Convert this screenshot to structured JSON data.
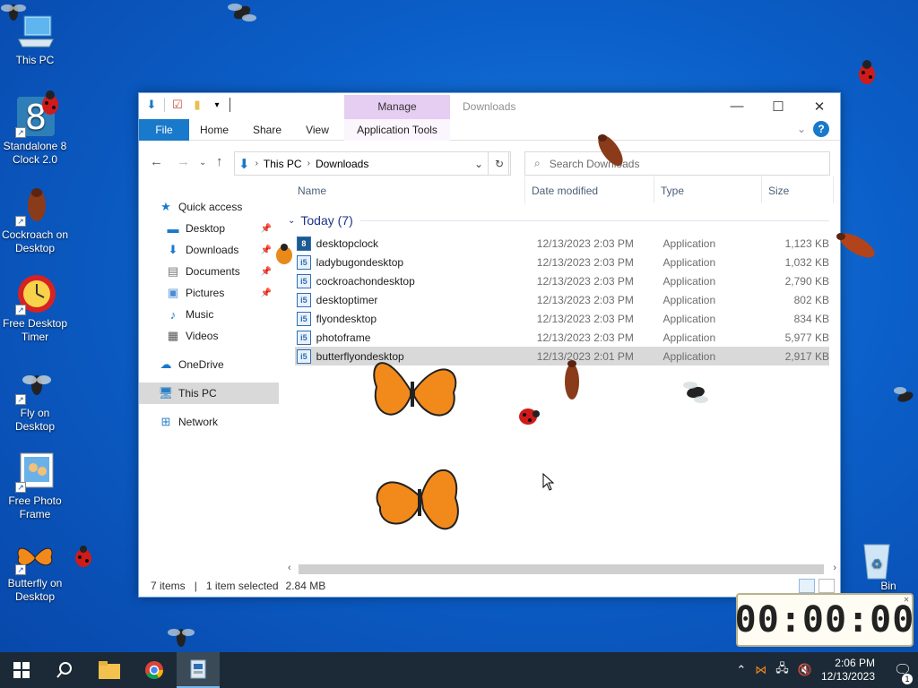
{
  "desktop": {
    "icons": [
      {
        "label": "This PC",
        "icon": "this-pc-icon"
      },
      {
        "label": "Standalone 8 Clock 2.0",
        "icon": "clock-8-icon"
      },
      {
        "label": "Cockroach on Desktop",
        "icon": "cockroach-icon"
      },
      {
        "label": "Free Desktop Timer",
        "icon": "timer-icon"
      },
      {
        "label": "Fly on Desktop",
        "icon": "fly-icon"
      },
      {
        "label": "Free Photo Frame",
        "icon": "photo-frame-icon"
      },
      {
        "label": "Butterfly on Desktop",
        "icon": "butterfly-icon"
      }
    ],
    "recycle_bin_label": "Bin"
  },
  "window": {
    "manage_tab": "Manage",
    "title": "Downloads",
    "ribbon_tabs": {
      "file": "File",
      "home": "Home",
      "share": "Share",
      "view": "View",
      "app_tools": "Application Tools"
    },
    "address": {
      "crumb1": "This PC",
      "crumb2": "Downloads"
    },
    "search_placeholder": "Search Downloads",
    "nav_pane": {
      "quick_access": "Quick access",
      "desktop": "Desktop",
      "downloads": "Downloads",
      "documents": "Documents",
      "pictures": "Pictures",
      "music": "Music",
      "videos": "Videos",
      "onedrive": "OneDrive",
      "this_pc": "This PC",
      "network": "Network"
    },
    "columns": {
      "name": "Name",
      "date": "Date modified",
      "type": "Type",
      "size": "Size"
    },
    "group_label": "Today (7)",
    "files": [
      {
        "name": "desktopclock",
        "date": "12/13/2023 2:03 PM",
        "type": "Application",
        "size": "1,123 KB"
      },
      {
        "name": "ladybugondesktop",
        "date": "12/13/2023 2:03 PM",
        "type": "Application",
        "size": "1,032 KB"
      },
      {
        "name": "cockroachondesktop",
        "date": "12/13/2023 2:03 PM",
        "type": "Application",
        "size": "2,790 KB"
      },
      {
        "name": "desktoptimer",
        "date": "12/13/2023 2:03 PM",
        "type": "Application",
        "size": "802 KB"
      },
      {
        "name": "flyondesktop",
        "date": "12/13/2023 2:03 PM",
        "type": "Application",
        "size": "834 KB"
      },
      {
        "name": "photoframe",
        "date": "12/13/2023 2:03 PM",
        "type": "Application",
        "size": "5,977 KB"
      },
      {
        "name": "butterflyondesktop",
        "date": "12/13/2023 2:01 PM",
        "type": "Application",
        "size": "2,917 KB"
      }
    ],
    "status": {
      "items": "7 items",
      "selected": "1 item selected",
      "size": "2.84 MB"
    }
  },
  "timer": {
    "display": "00:00:00"
  },
  "taskbar": {
    "time": "2:06 PM",
    "date": "12/13/2023",
    "notification_count": "1"
  },
  "colors": {
    "accent": "#1979ca",
    "manage": "#e6cdf2",
    "taskbar": "#1b2a36"
  }
}
